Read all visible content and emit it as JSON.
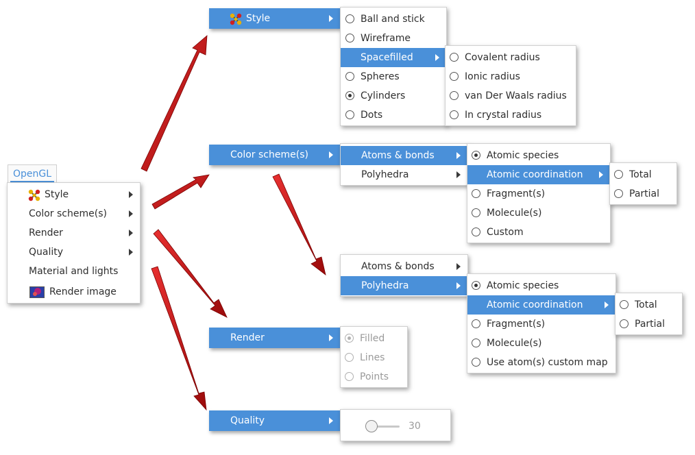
{
  "opengl_tab": "OpenGL",
  "main_menu": {
    "style": "Style",
    "color_schemes": "Color scheme(s)",
    "render": "Render",
    "quality": "Quality",
    "material_lights": "Material and lights",
    "render_image": "Render image"
  },
  "style_menu": {
    "title": "Style",
    "items": [
      "Ball and stick",
      "Wireframe",
      "Spacefilled",
      "Spheres",
      "Cylinders",
      "Dots"
    ],
    "checked": "Cylinders"
  },
  "spacefilled_menu": {
    "items": [
      "Covalent radius",
      "Ionic radius",
      "van Der Waals radius",
      "In crystal radius"
    ]
  },
  "color_menu": {
    "title": "Color scheme(s)",
    "items": [
      "Atoms & bonds",
      "Polyhedra"
    ]
  },
  "atoms_bonds_menu": {
    "items": [
      "Atomic species",
      "Atomic coordination",
      "Fragment(s)",
      "Molecule(s)",
      "Custom"
    ],
    "checked": "Atomic species"
  },
  "coordination_menu": {
    "items": [
      "Total",
      "Partial"
    ]
  },
  "color_menu2": {
    "items": [
      "Atoms & bonds",
      "Polyhedra"
    ]
  },
  "polyhedra_menu": {
    "items": [
      "Atomic species",
      "Atomic coordination",
      "Fragment(s)",
      "Molecule(s)",
      "Use atom(s) custom map"
    ],
    "checked": "Atomic species"
  },
  "coordination_menu2": {
    "items": [
      "Total",
      "Partial"
    ]
  },
  "render_menu": {
    "title": "Render",
    "items": [
      "Filled",
      "Lines",
      "Points"
    ],
    "checked": "Filled"
  },
  "quality_menu": {
    "title": "Quality",
    "slider_value": "30",
    "slider_level": 0.0
  },
  "colors": {
    "accent": "#4a90d9",
    "arrow": "#c81414"
  },
  "icons": {
    "style": "molecule-icon",
    "render_image": "render-image-icon"
  }
}
